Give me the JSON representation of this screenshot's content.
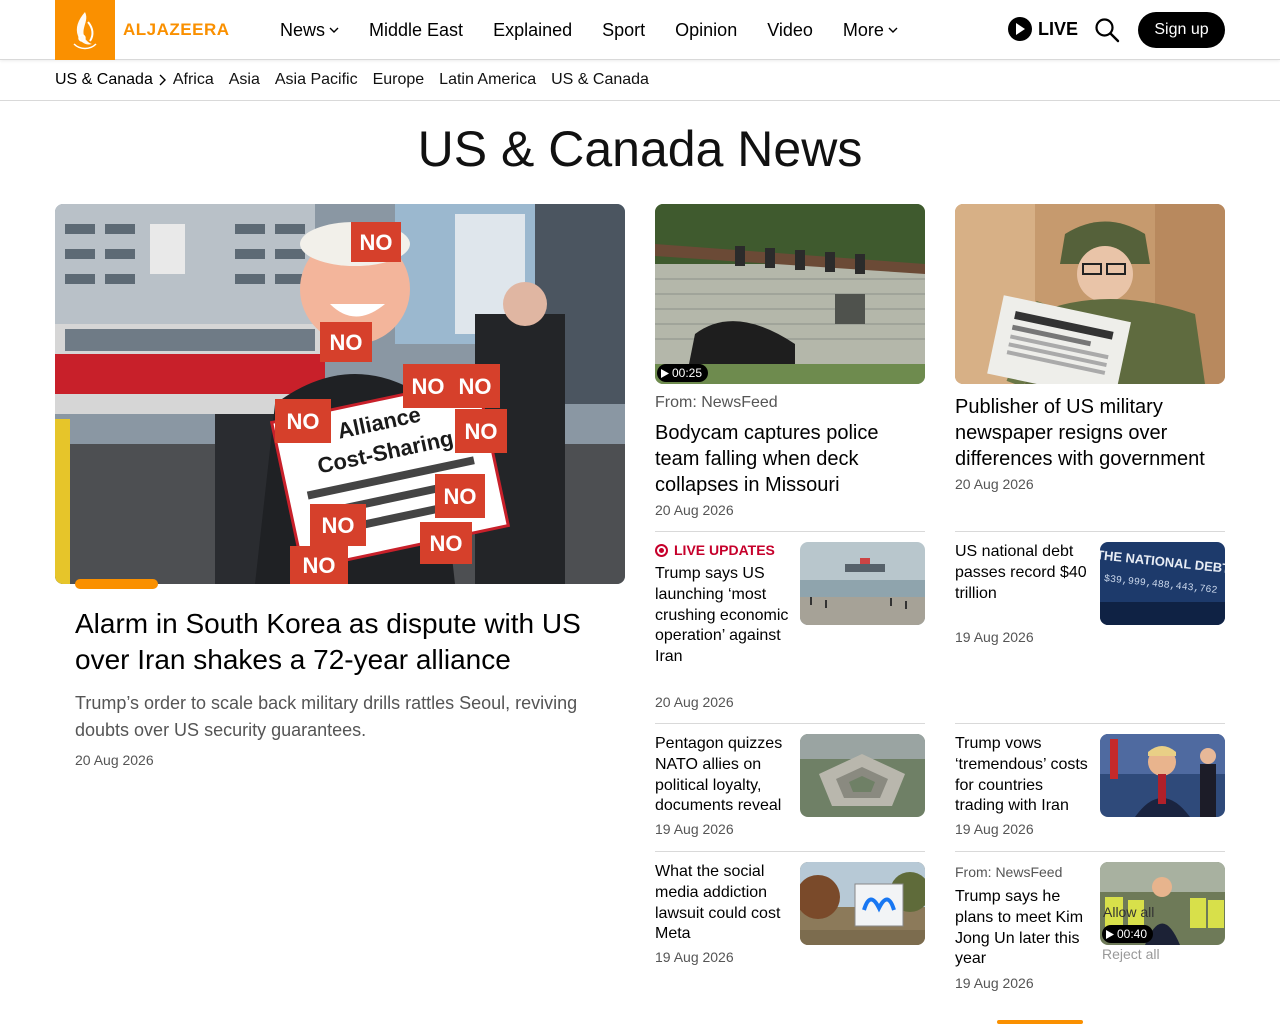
{
  "header": {
    "logo_text": "ALJAZEERA",
    "nav": [
      {
        "label": "News",
        "dropdown": true
      },
      {
        "label": "Middle East",
        "dropdown": false
      },
      {
        "label": "Explained",
        "dropdown": false
      },
      {
        "label": "Sport",
        "dropdown": false
      },
      {
        "label": "Opinion",
        "dropdown": false
      },
      {
        "label": "Video",
        "dropdown": false
      },
      {
        "label": "More",
        "dropdown": true
      }
    ],
    "live_label": "LIVE",
    "signup_label": "Sign up"
  },
  "subnav": {
    "breadcrumb": "US & Canada",
    "items": [
      "Africa",
      "Asia",
      "Asia Pacific",
      "Europe",
      "Latin America",
      "US & Canada"
    ]
  },
  "page_title": "US & Canada News",
  "lead": {
    "title": "Alarm in South Korea as dispute with US over Iran shakes a 72-year alliance",
    "summary": "Trump’s order to scale back military drills rattles Seoul, reviving doubts over US security guarantees.",
    "date": "20 Aug 2026",
    "image_sign": {
      "line1": "Alliance",
      "line2": "Cost-Sharing",
      "no": "NO"
    }
  },
  "cards": {
    "c1": {
      "duration": "00:25",
      "source": "From: NewsFeed",
      "title": "Bodycam captures police team falling when deck collapses in Missouri",
      "date": "20 Aug 2026"
    },
    "c2": {
      "title": "Publisher of US military newspaper resigns over differences with government",
      "date": "20 Aug 2026"
    },
    "s1": {
      "live_label": "LIVE UPDATES",
      "title": "Trump says US launching ‘most crushing economic operation’ against Iran",
      "date": "20 Aug 2026"
    },
    "s2": {
      "title": "US national debt passes record $40 trillion",
      "date": "19 Aug 2026",
      "img_text": "THE NATIONAL DEBT",
      "img_number": "$39,999,488,443,762"
    },
    "s3": {
      "title": "Pentagon quizzes NATO allies on political loyalty, documents reveal",
      "date": "19 Aug 2026"
    },
    "s4": {
      "title": "Trump vows ‘tremendous’ costs for countries trading with Iran",
      "date": "19 Aug 2026"
    },
    "s5": {
      "title": "What the social media addiction lawsuit could cost Meta",
      "date": "19 Aug 2026"
    },
    "s6": {
      "source": "From: NewsFeed",
      "title": "Trump says he plans to meet Kim Jong Un later this year",
      "date": "19 Aug 2026",
      "duration": "00:40"
    }
  },
  "cookie": {
    "allow_label": "Allow all",
    "reject_label": "Reject all"
  },
  "colors": {
    "brand": "#fa9000",
    "live_red": "#c6002b",
    "text_muted": "#555555"
  }
}
